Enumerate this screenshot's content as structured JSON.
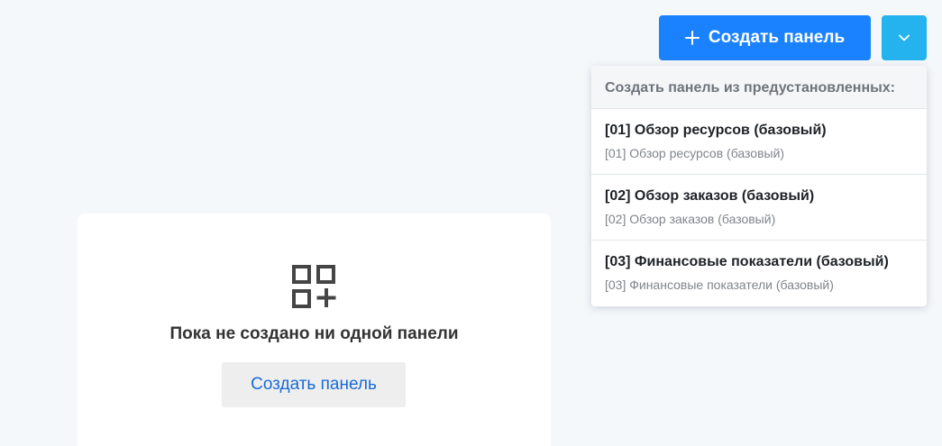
{
  "toolbar": {
    "create_label": "Создать панель",
    "create_icon": "plus-icon",
    "dropdown_icon": "chevron-down-icon"
  },
  "dropdown": {
    "header": "Создать панель из предустановленных:",
    "items": [
      {
        "title": "[01] Обзор ресурсов (базовый)",
        "subtitle": "[01] Обзор ресурсов (базовый)"
      },
      {
        "title": "[02] Обзор заказов (базовый)",
        "subtitle": "[02] Обзор заказов (базовый)"
      },
      {
        "title": "[03] Финансовые показатели (базовый)",
        "subtitle": "[03] Финансовые показатели (базовый)"
      }
    ]
  },
  "empty_state": {
    "icon": "dashboard-add-icon",
    "title": "Пока не создано ни одной панели",
    "create_label": "Создать панель"
  },
  "colors": {
    "primary": "#1a82ff",
    "dropdown_toggle": "#24b3ee",
    "link": "#1a6ad6",
    "background": "#f5f8fb"
  }
}
